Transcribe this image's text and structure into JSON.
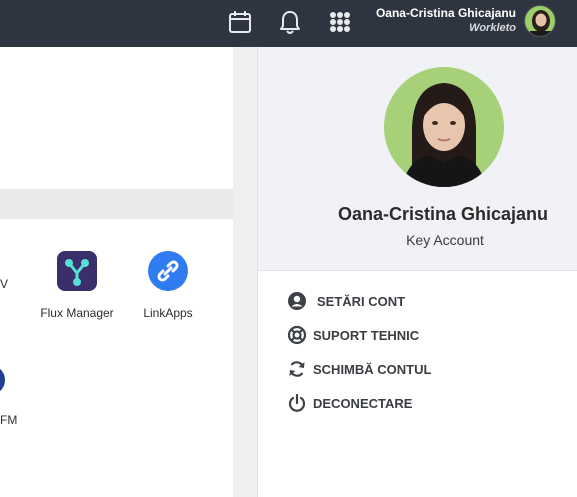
{
  "topbar": {
    "user_name": "Oana-Cristina Ghicajanu",
    "organization": "Workleto",
    "icons": [
      "calendar-icon",
      "bell-icon",
      "apps-grid-icon"
    ]
  },
  "apps": [
    {
      "label": "Flux Manager",
      "icon": "flux-manager-icon"
    },
    {
      "label": "LinkApps",
      "icon": "link-icon"
    }
  ],
  "partial_labels": {
    "row1_right": "V",
    "row2_right": "FM"
  },
  "profile": {
    "name": "Oana-Cristina Ghicajanu",
    "role": "Key Account"
  },
  "menu": [
    {
      "label": "SETĂRI CONT",
      "icon": "account-circle-icon"
    },
    {
      "label": "SUPORT TEHNIC",
      "icon": "lifebuoy-icon"
    },
    {
      "label": "SCHIMBĂ CONTUL",
      "icon": "refresh-icon"
    },
    {
      "label": "DECONECTARE",
      "icon": "power-icon"
    }
  ],
  "colors": {
    "topbar": "#2e3540",
    "accent_blue": "#2f7bf0",
    "flux_icon_bg": "#3b2f6b"
  }
}
